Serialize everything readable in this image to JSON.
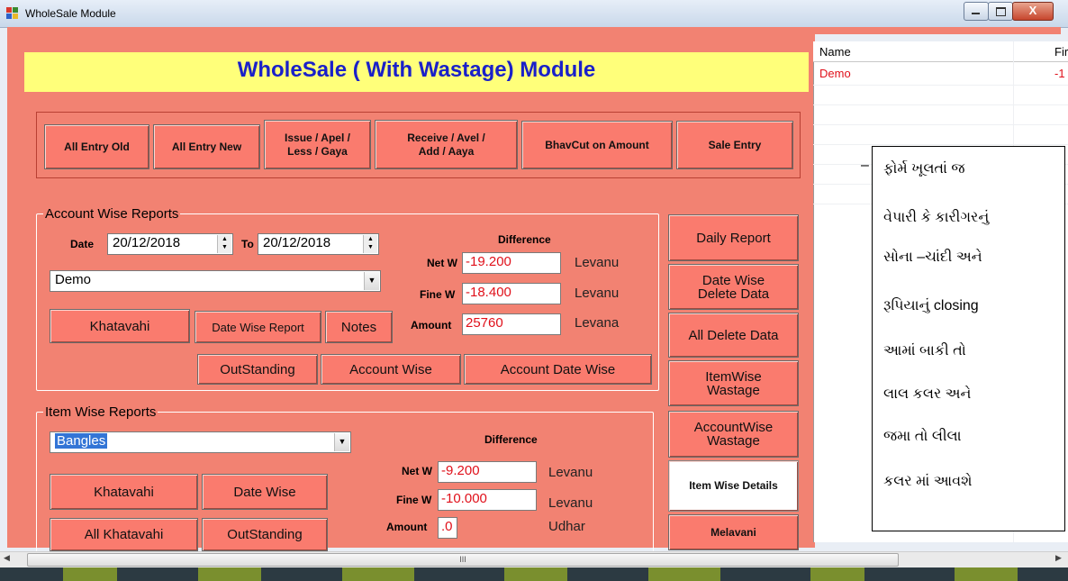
{
  "window": {
    "title": "WholeSale Module",
    "close_glyph": "X"
  },
  "header": {
    "title": "WholeSale ( With Wastage) Module"
  },
  "toolbar": {
    "all_entry_old": "All Entry Old",
    "all_entry_new": "All Entry New",
    "issue_line1": "Issue / Apel /",
    "issue_line2": "Less / Gaya",
    "receive_line1": "Receive / Avel /",
    "receive_line2": "Add / Aaya",
    "bhavcut": "BhavCut on Amount",
    "sale_entry": "Sale  Entry"
  },
  "account_reports": {
    "title": "Account Wise Reports",
    "date_label": "Date",
    "date_from": "20/12/2018",
    "to_label": "To",
    "date_to": "20/12/2018",
    "account": "Demo",
    "difference_label": "Difference",
    "net_w_label": "Net W",
    "net_w": "-19.200",
    "net_w_status": "Levanu",
    "fine_w_label": "Fine W",
    "fine_w": "-18.400",
    "fine_w_status": "Levanu",
    "amount_label": "Amount",
    "amount": "25760",
    "amount_status": "Levana",
    "khatavahi": "Khatavahi",
    "date_wise_report": "Date Wise Report",
    "notes": "Notes",
    "outstanding": "OutStanding",
    "account_wise": "Account Wise",
    "account_date_wise": "Account Date Wise"
  },
  "item_reports": {
    "title": "Item Wise Reports",
    "item": "Bangles",
    "difference_label": "Difference",
    "net_w_label": "Net W",
    "net_w": "-9.200",
    "net_w_status": "Levanu",
    "fine_w_label": "Fine W",
    "fine_w": "-10.000",
    "fine_w_status": "Levanu",
    "amount_label": "Amount",
    "amount": ".0",
    "amount_status": "Udhar",
    "khatavahi": "Khatavahi",
    "date_wise": "Date Wise",
    "all_khatavahi": "All Khatavahi",
    "outstanding": "OutStanding"
  },
  "side_buttons": {
    "daily_report": "Daily Report",
    "date_wise_delete_1": "Date Wise",
    "date_wise_delete_2": "Delete Data",
    "all_delete_data": "All Delete Data",
    "itemwise_wastage_1": "ItemWise",
    "itemwise_wastage_2": "Wastage",
    "accountwise_wastage_1": "AccountWise",
    "accountwise_wastage_2": "Wastage",
    "item_wise_details": "Item Wise Details",
    "melavani": "Melavani"
  },
  "grid": {
    "col_name": "Name",
    "col_fine": "Fir",
    "row_name": "Demo",
    "row_fine": "-1"
  },
  "note": {
    "dash": "–",
    "lines": [
      "ફોર્મ ખૂલતાં જ",
      "વેપારી કે કારીગરનું",
      "સોના –ચાંદી અને",
      "રૂપિયાનું closing",
      "આમાં બાકી તો",
      "લાલ કલર અને",
      "જમા તો લીલા",
      "કલર  માં આવશે"
    ]
  },
  "scrollbar": {
    "thumb_grip": "III"
  },
  "colors": {
    "form_bg": "#f28272",
    "header_bg": "#ffff7a",
    "title_blue": "#1a20c9",
    "negative_red": "#e0101a"
  }
}
